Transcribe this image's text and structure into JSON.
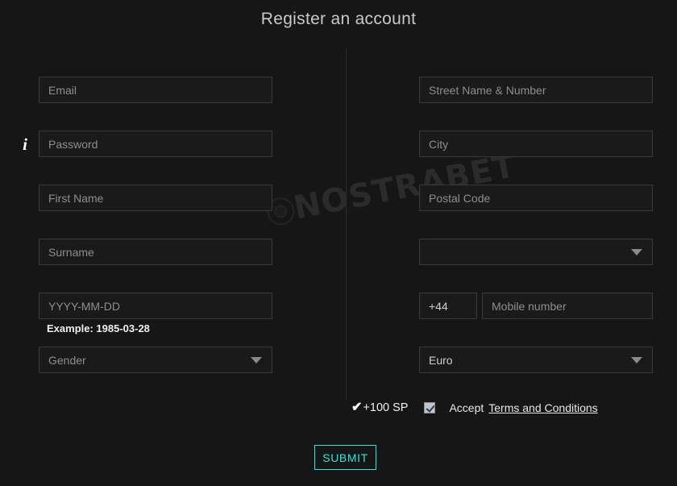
{
  "page": {
    "title": "Register an account",
    "watermark": "NOSTRABET",
    "background_color": "#161616",
    "accent_color": "#2ee6e0"
  },
  "form": {
    "left_column": {
      "email": {
        "placeholder": "Email",
        "value": ""
      },
      "password": {
        "placeholder": "Password",
        "value": ""
      },
      "first_name": {
        "placeholder": "First Name",
        "value": ""
      },
      "surname": {
        "placeholder": "Surname",
        "value": ""
      },
      "birthdate": {
        "placeholder": "YYYY-MM-DD",
        "value": "",
        "helper": "Example: 1985-03-28"
      },
      "gender": {
        "selected": "Gender"
      },
      "info_icon": "i"
    },
    "right_column": {
      "street": {
        "placeholder": "Street Name & Number",
        "value": ""
      },
      "city": {
        "placeholder": "City",
        "value": ""
      },
      "postal_code": {
        "placeholder": "Postal Code",
        "value": ""
      },
      "country": {
        "selected": ""
      },
      "phone_prefix": {
        "value": "+44"
      },
      "mobile_number": {
        "placeholder": "Mobile number",
        "value": ""
      },
      "currency": {
        "selected": "Euro"
      }
    }
  },
  "terms": {
    "check_glyph": "✔",
    "sp_bonus": "+100 SP",
    "checkbox_checked": true,
    "accept_label": "Accept",
    "link_label": "Terms and Conditions"
  },
  "submit": {
    "label": "SUBMIT"
  }
}
